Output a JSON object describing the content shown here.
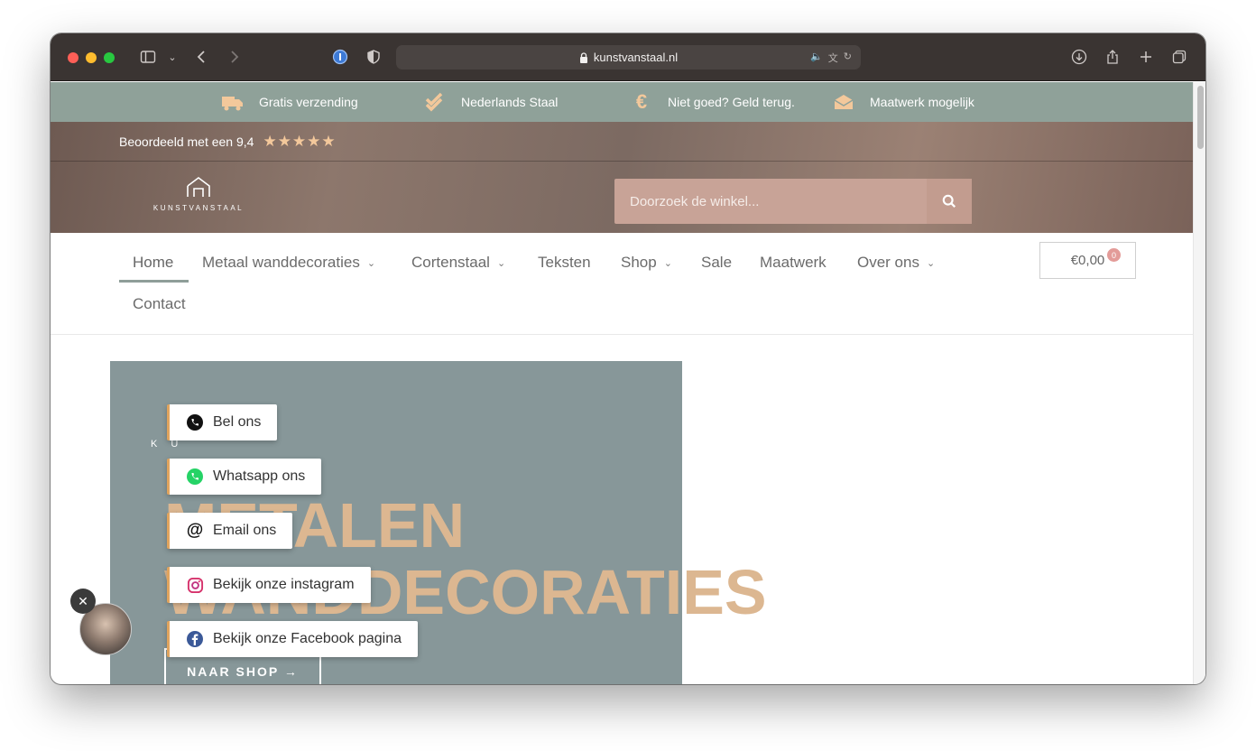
{
  "browser": {
    "url": "kunstvanstaal.nl"
  },
  "usp": [
    {
      "icon": "truck-icon",
      "label": "Gratis verzending"
    },
    {
      "icon": "double-check-icon",
      "label": "Nederlands Staal"
    },
    {
      "icon": "euro-icon",
      "label": "Niet goed? Geld terug."
    },
    {
      "icon": "box-icon",
      "label": "Maatwerk mogelijk"
    }
  ],
  "rating": {
    "label": "Beoordeeld met een 9,4",
    "stars": "★★★★★"
  },
  "logo": {
    "word": "KUNSTVANSTAAL"
  },
  "search": {
    "placeholder": "Doorzoek de winkel..."
  },
  "nav": {
    "items": [
      "Home",
      "Metaal wanddecoraties",
      "Cortenstaal",
      "Teksten",
      "Shop",
      "Sale",
      "Maatwerk",
      "Over ons",
      "Contact"
    ],
    "chevron": "⌄"
  },
  "cart": {
    "total": "€0,00",
    "count": "0"
  },
  "banner": {
    "logo_word": "K U",
    "title_line1": "METALEN",
    "title_line2": "WANDDECORATIES",
    "shop_button": "NAAR SHOP →"
  },
  "contact_buttons": [
    {
      "label": "Bel ons",
      "icon": "phone-icon"
    },
    {
      "label": "Whatsapp ons",
      "icon": "whatsapp-icon"
    },
    {
      "label": "Email ons",
      "icon": "at-icon"
    },
    {
      "label": "Bekijk onze instagram",
      "icon": "instagram-icon"
    },
    {
      "label": "Bekijk onze Facebook pagina",
      "icon": "facebook-icon"
    }
  ],
  "colors": {
    "usp_bar": "#8fa199",
    "accent": "#f3c89b",
    "banner": "#879799",
    "title": "#dcb791",
    "search": "#c8a397"
  }
}
